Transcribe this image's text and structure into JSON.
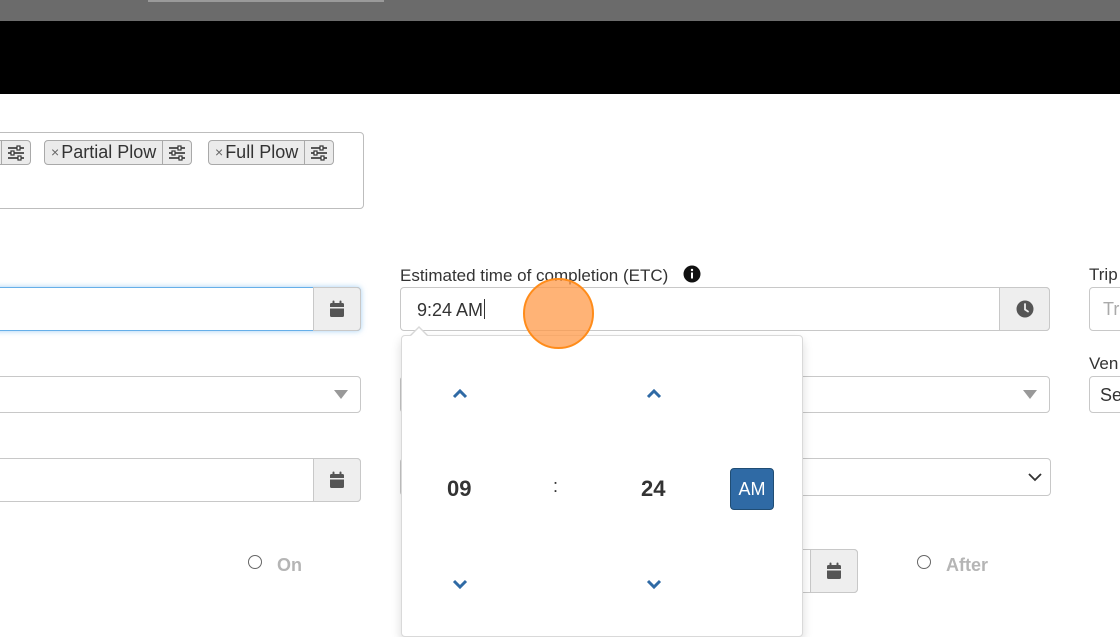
{
  "tags": [
    {
      "label": ""
    },
    {
      "label": "Partial Plow"
    },
    {
      "label": "Full Plow"
    }
  ],
  "tag_remove_glyph": "×",
  "etc": {
    "label": "Estimated time of completion (ETC)",
    "value": "9:24 AM"
  },
  "trip": {
    "label": "Trip",
    "placeholder": "Tr"
  },
  "vendor": {
    "label": "Ven",
    "value": "Se"
  },
  "radio_on": {
    "label": "On"
  },
  "radio_after": {
    "label": "After"
  },
  "timepicker": {
    "hours": "09",
    "separator": ":",
    "minutes": "24",
    "meridian": "AM"
  },
  "colors": {
    "primary": "#2f6aa5",
    "focus_border": "#66afe9",
    "cursor_highlight": "#ff9948"
  }
}
